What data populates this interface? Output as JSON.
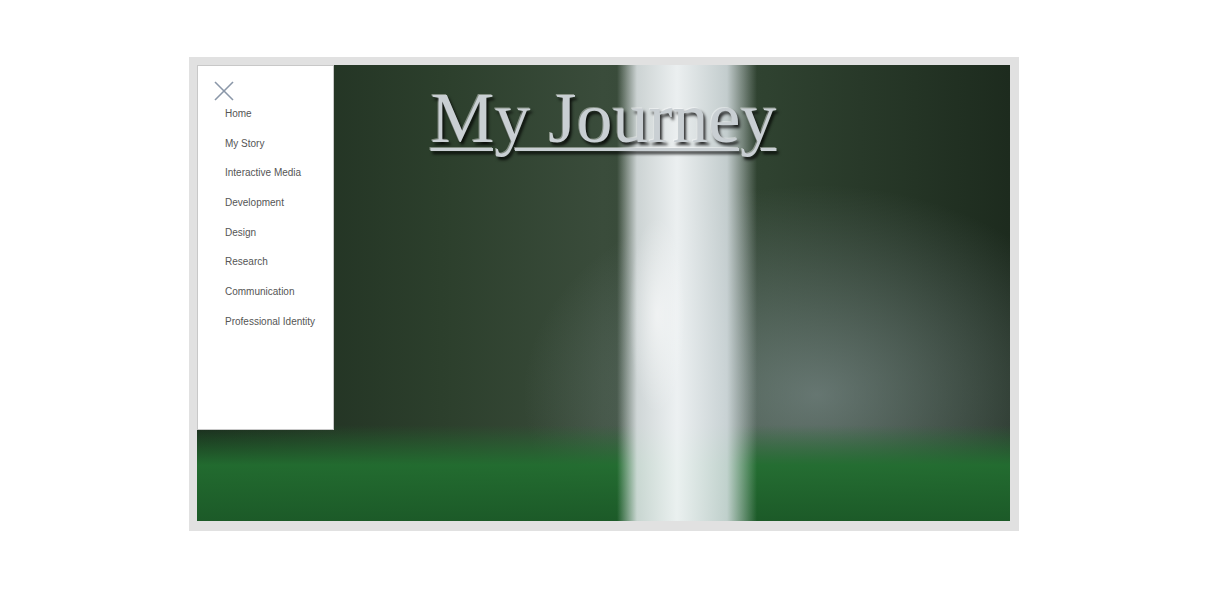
{
  "page": {
    "title": "My Journey"
  },
  "menu": {
    "items": [
      "Home",
      "My Story",
      "Interactive Media",
      "Development",
      "Design",
      "Research",
      "Communication",
      "Professional Identity"
    ]
  }
}
